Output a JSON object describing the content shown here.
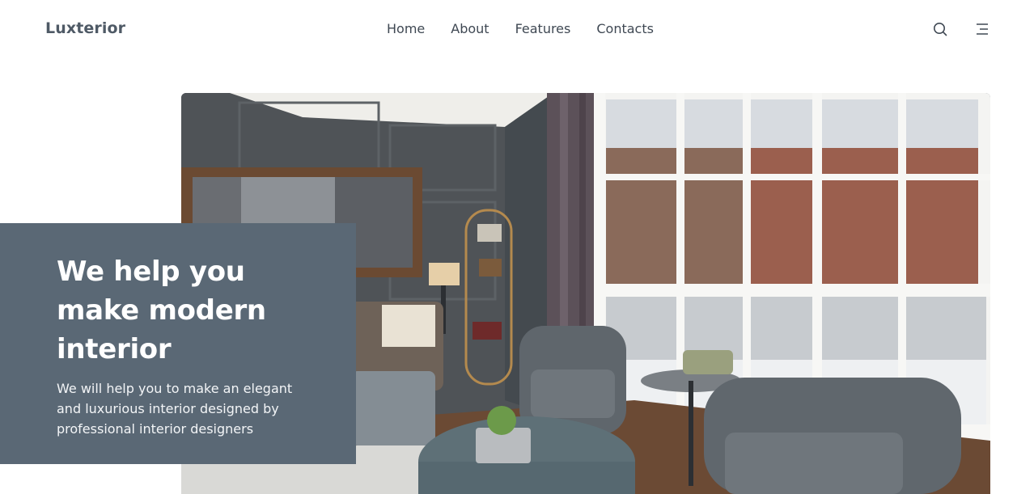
{
  "brand": {
    "logo": "Luxterior"
  },
  "nav": {
    "items": [
      "Home",
      "About",
      "Features",
      "Contacts"
    ]
  },
  "header_icons": {
    "search": "search-icon",
    "menu": "menu-icon"
  },
  "hero": {
    "heading": "We help you make modern interior",
    "description": "We will help you to make an elegant and luxurious interior designed by professional interior designers",
    "image": "living-room-photo"
  },
  "colors": {
    "panel": "#5a6875",
    "text": "#3f4853",
    "white": "#ffffff"
  }
}
